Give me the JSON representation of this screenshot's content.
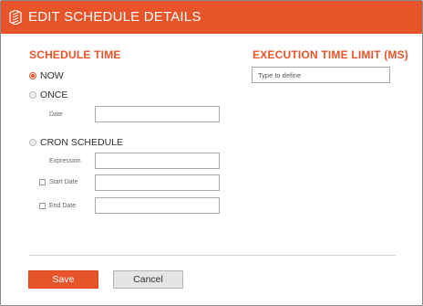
{
  "dialog": {
    "title": "EDIT SCHEDULE DETAILS",
    "header_color": "#e8542a",
    "logo_icon": "brand-logo-icon"
  },
  "schedule_time": {
    "heading": "SCHEDULE TIME",
    "options": {
      "now": {
        "label": "NOW",
        "checked": true
      },
      "once": {
        "label": "ONCE",
        "checked": false
      },
      "cron": {
        "label": "CRON SCHEDULE",
        "checked": false
      }
    },
    "once_date": {
      "label": "Date",
      "value": ""
    },
    "cron_expression": {
      "label": "Expression",
      "value": ""
    },
    "cron_start_date": {
      "label": "Start Date",
      "checked": false,
      "value": ""
    },
    "cron_end_date": {
      "label": "End Date",
      "checked": false,
      "value": ""
    }
  },
  "execution_limit": {
    "heading": "EXECUTION TIME LIMIT (MS)",
    "placeholder": "Type to define",
    "value": ""
  },
  "buttons": {
    "save": "Save",
    "cancel": "Cancel"
  },
  "colors": {
    "accent": "#e8542a",
    "cancel_bg": "#e5e5e5"
  }
}
